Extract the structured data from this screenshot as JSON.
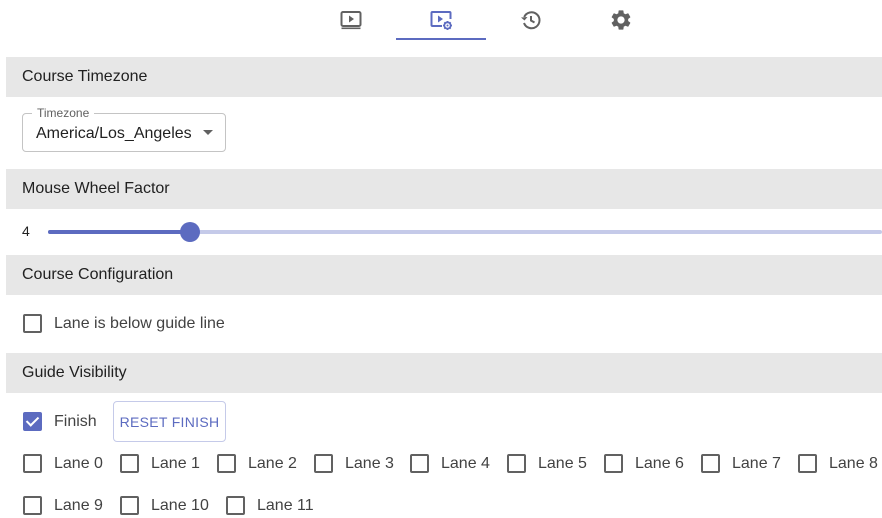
{
  "tabs": [
    {
      "icon": "play-screen-icon",
      "selected": false
    },
    {
      "icon": "video-settings-icon",
      "selected": true
    },
    {
      "icon": "history-icon",
      "selected": false
    },
    {
      "icon": "gear-icon",
      "selected": false
    }
  ],
  "accent_color": "#5c6bc0",
  "timezone_section": {
    "title": "Course Timezone",
    "field_label": "Timezone",
    "value": "America/Los_Angeles"
  },
  "mouse_wheel_section": {
    "title": "Mouse Wheel Factor",
    "value": "4",
    "slider_fraction": 0.17
  },
  "course_config_section": {
    "title": "Course Configuration",
    "lane_below_label": "Lane is below guide line",
    "lane_below_checked": false
  },
  "guide_visibility_section": {
    "title": "Guide Visibility",
    "finish_label": "Finish",
    "finish_checked": true,
    "reset_button_label": "RESET FINISH",
    "lanes": [
      "Lane 0",
      "Lane 1",
      "Lane 2",
      "Lane 3",
      "Lane 4",
      "Lane 5",
      "Lane 6",
      "Lane 7",
      "Lane 8",
      "Lane 9",
      "Lane 10",
      "Lane 11"
    ]
  }
}
